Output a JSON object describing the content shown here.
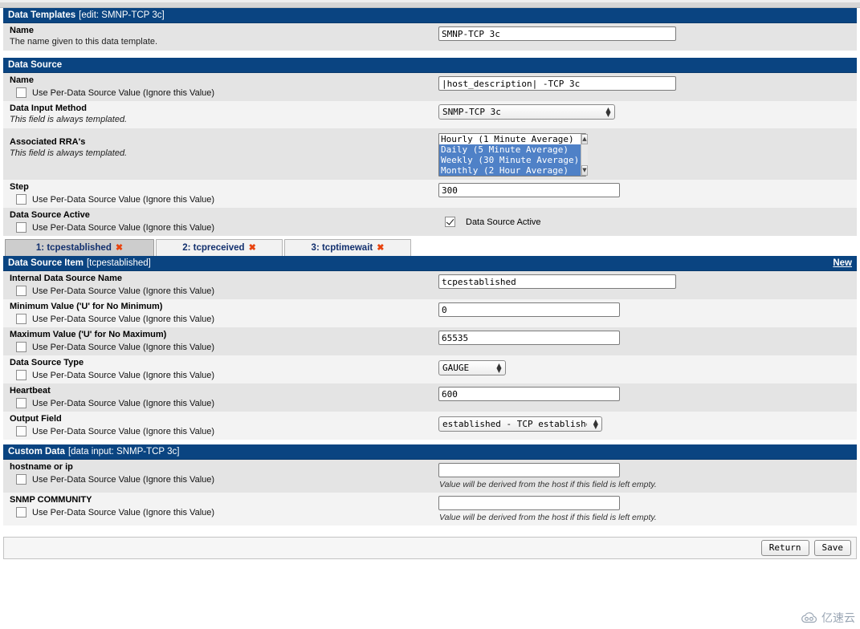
{
  "app": {
    "accent_blue": "#0a4481",
    "row_alt_a": "#e4e4e4",
    "row_alt_b": "#f3f3f3",
    "tab_link_color": "#12306e",
    "delete_x_color": "#e8430f"
  },
  "sections": {
    "data_templates": {
      "title": "Data Templates",
      "subtitle": "[edit: SMNP-TCP 3c]",
      "name_label": "Name",
      "name_desc": "The name given to this data template.",
      "name_value": "SMNP-TCP 3c"
    },
    "data_source": {
      "title": "Data Source",
      "fields": [
        {
          "label": "Name",
          "desc": "",
          "checkbox_label": "Use Per-Data Source Value (Ignore this Value)",
          "value": "|host_description| -TCP 3c"
        },
        {
          "label": "Data Input Method",
          "desc": "This field is always templated.",
          "checkbox_label": "",
          "value": "SNMP-TCP 3c"
        },
        {
          "label": "Associated RRA's",
          "desc": "This field is always templated.",
          "checkbox_label": "",
          "value": ""
        },
        {
          "label": "Step",
          "desc": "",
          "checkbox_label": "Use Per-Data Source Value (Ignore this Value)",
          "value": "300"
        },
        {
          "label": "Data Source Active",
          "desc": "",
          "checkbox_label": "Use Per-Data Source Value (Ignore this Value)",
          "value": "Data Source Active"
        }
      ],
      "rra_options": [
        {
          "label": "Hourly (1 Minute Average)",
          "selected": false
        },
        {
          "label": "Daily (5 Minute Average)",
          "selected": true
        },
        {
          "label": "Weekly (30 Minute Average)",
          "selected": true
        },
        {
          "label": "Monthly (2 Hour Average)",
          "selected": true
        }
      ],
      "scroll_up_icon": "scroll-up-arrow",
      "scroll_down_icon": "scroll-down-arrow",
      "active_checked": true
    },
    "tabs": [
      {
        "label": "1: tcpestablished",
        "close": "✖",
        "active": true
      },
      {
        "label": "2: tcpreceived",
        "close": "✖",
        "active": false
      },
      {
        "label": "3: tcptimewait",
        "close": "✖",
        "active": false
      }
    ],
    "data_source_item": {
      "title": "Data Source Item",
      "subtitle": "[tcpestablished]",
      "new_link": "New",
      "checkbox_label": "Use Per-Data Source Value (Ignore this Value)",
      "fields": [
        {
          "label": "Internal Data Source Name",
          "type": "text",
          "value": "tcpestablished"
        },
        {
          "label": "Minimum Value ('U' for No Minimum)",
          "type": "text",
          "value": "0"
        },
        {
          "label": "Maximum Value ('U' for No Maximum)",
          "type": "text",
          "value": "65535"
        },
        {
          "label": "Data Source Type",
          "type": "select",
          "value": "GAUGE"
        },
        {
          "label": "Heartbeat",
          "type": "text",
          "value": "600"
        },
        {
          "label": "Output Field",
          "type": "select",
          "value": "established - TCP established"
        }
      ]
    },
    "custom_data": {
      "title": "Custom Data",
      "subtitle": "[data input: SNMP-TCP 3c]",
      "checkbox_label": "Use Per-Data Source Value (Ignore this Value)",
      "hint": "Value will be derived from the host if this field is left empty.",
      "fields": [
        {
          "label": "hostname or ip",
          "value": ""
        },
        {
          "label": "SNMP COMMUNITY",
          "value": ""
        }
      ]
    },
    "actions": {
      "return_label": "Return",
      "save_label": "Save"
    },
    "watermark": {
      "text": "亿速云"
    }
  }
}
